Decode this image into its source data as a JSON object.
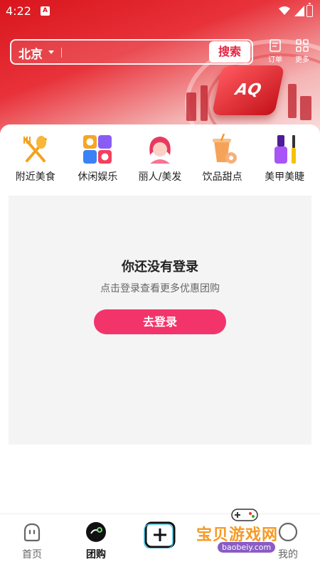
{
  "status_bar": {
    "time": "4:22",
    "notif_letter": "A"
  },
  "header": {
    "city": "北京",
    "search_button": "搜索",
    "order_label": "订单",
    "more_label": "更多",
    "banner_text": "AQ"
  },
  "categories": [
    {
      "label": "附近美食",
      "icon": "fork-spoon-icon"
    },
    {
      "label": "休闲娱乐",
      "icon": "leisure-grid-icon"
    },
    {
      "label": "丽人/美发",
      "icon": "woman-hair-icon"
    },
    {
      "label": "饮品甜点",
      "icon": "drink-dessert-icon"
    },
    {
      "label": "美甲美睫",
      "icon": "nail-mascara-icon"
    }
  ],
  "empty_state": {
    "title": "你还没有登录",
    "subtitle": "点击登录查看更多优惠团购",
    "login_button": "去登录"
  },
  "bottom_nav": {
    "items": [
      {
        "label": "首页",
        "icon": "home-face-icon",
        "active": false
      },
      {
        "label": "团购",
        "icon": "group-buy-icon",
        "active": true
      },
      {
        "label": "",
        "icon": "add-icon",
        "active": false
      },
      {
        "label": "我的",
        "icon": "profile-icon",
        "active": false
      }
    ]
  },
  "watermark": {
    "title": "宝贝游戏网",
    "url": "baobeiy.com"
  },
  "colors": {
    "brand_red": "#e62243",
    "login_pink": "#f2346b",
    "header_red": "#d9151c"
  }
}
